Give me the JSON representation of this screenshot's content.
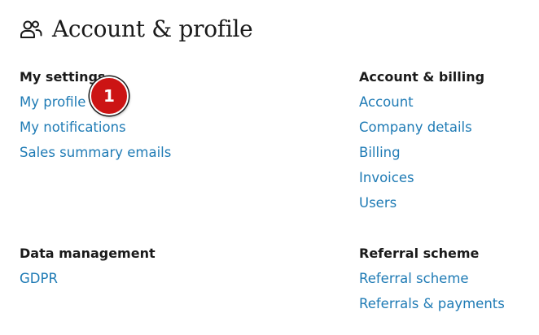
{
  "header": {
    "icon": "users-icon",
    "title": "Account & profile"
  },
  "sections": {
    "my_settings": {
      "heading": "My settings",
      "links": [
        "My profile",
        "My notifications",
        "Sales summary emails"
      ]
    },
    "account_billing": {
      "heading": "Account & billing",
      "links": [
        "Account",
        "Company details",
        "Billing",
        "Invoices",
        "Users"
      ]
    },
    "data_management": {
      "heading": "Data management",
      "links": [
        "GDPR"
      ]
    },
    "referral_scheme": {
      "heading": "Referral scheme",
      "links": [
        "Referral scheme",
        "Referrals & payments"
      ]
    }
  },
  "annotation": {
    "step_number": "1"
  },
  "colors": {
    "link": "#1f7bb5",
    "text": "#1a1a1a",
    "badge": "#cc1414"
  }
}
